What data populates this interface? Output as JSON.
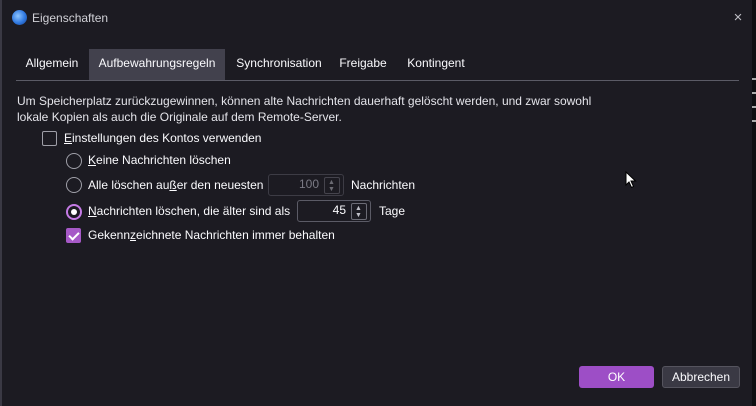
{
  "window": {
    "title": "Eigenschaften",
    "close_icon": "×"
  },
  "tabs": [
    {
      "label": "Allgemein",
      "active": false
    },
    {
      "label": "Aufbewahrungsregeln",
      "active": true
    },
    {
      "label": "Synchronisation",
      "active": false
    },
    {
      "label": "Freigabe",
      "active": false
    },
    {
      "label": "Kontingent",
      "active": false
    }
  ],
  "retention": {
    "description_line1": "Um Speicherplatz zurückzugewinnen, können alte Nachrichten dauerhaft gelöscht werden, und zwar sowohl",
    "description_line2": "lokale Kopien als auch die Originale auf dem Remote-Server.",
    "use_account_settings": {
      "label_accel": "E",
      "label_rest": "instellungen des Kontos verwenden",
      "checked": false
    },
    "options": {
      "keep_all": {
        "label_accel": "K",
        "label_rest": "eine Nachrichten löschen",
        "selected": false
      },
      "keep_newest": {
        "label_pre": "Alle löschen au",
        "label_accel": "ß",
        "label_post": "er den neuesten",
        "value": "100",
        "suffix": "Nachrichten",
        "selected": false,
        "enabled": false
      },
      "delete_older": {
        "label_accel": "N",
        "label_rest": "achrichten löschen, die älter sind als",
        "value": "45",
        "suffix": "Tage",
        "selected": true,
        "enabled": true
      }
    },
    "keep_flagged": {
      "label_pre": "Gekenn",
      "label_accel": "z",
      "label_post": "eichnete Nachrichten immer behalten",
      "checked": true
    }
  },
  "buttons": {
    "ok": "OK",
    "cancel": "Abbrechen"
  },
  "colors": {
    "accent": "#9d4ec6",
    "background": "#1c1b22",
    "active_tab": "#42414d"
  }
}
